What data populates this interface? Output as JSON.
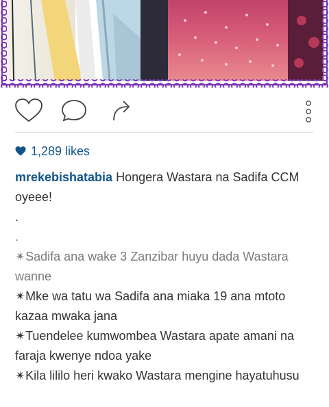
{
  "post": {
    "image_icon": "photo-of-bride-in-sparkly-gown",
    "likes_icon": "heart-icon",
    "likes": "1,289 likes",
    "username": "mrekebishatabia",
    "caption_first": " Hongera Wastara na Sadifa CCM oyeee!",
    "caption_lines": [
      ".",
      ".",
      "✴Sadifa ana wake 3 Zanzibar huyu dada Wastara wanne",
      "✴Mke wa tatu wa Sadifa ana miaka 19 ana mtoto kazaa mwaka jana",
      "✴Tuendelee kumwombea Wastara apate amani na faraja kwenye ndoa yake",
      "✴Kila lililo heri kwako Wastara mengine hayatuhusu"
    ]
  },
  "actions": {
    "like_icon": "heart-outline-icon",
    "comment_icon": "comment-bubble-icon",
    "share_icon": "share-arrow-icon",
    "more_icon": "more-options-icon"
  },
  "colors": {
    "link_blue": "#125688",
    "frame_purple": "#7a35b8",
    "text": "#333333"
  }
}
